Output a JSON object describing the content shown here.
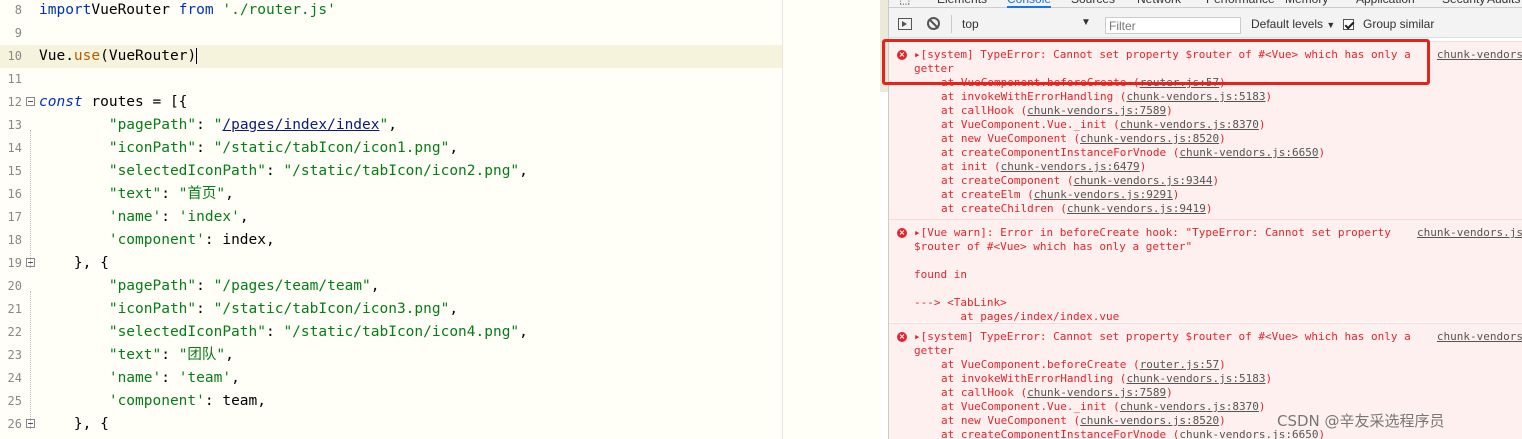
{
  "editor": {
    "lines": [
      {
        "n": "8",
        "indent": 0,
        "parts": [
          [
            "kw",
            "import"
          ],
          [
            "",
            "VueRouter "
          ],
          [
            "kw",
            "from"
          ],
          [
            "",
            " "
          ],
          [
            "str",
            "'./router.js'"
          ]
        ]
      },
      {
        "n": "9",
        "indent": 0,
        "parts": []
      },
      {
        "n": "10",
        "indent": 0,
        "hl": true,
        "parts": [
          [
            "",
            "Vue."
          ],
          [
            "fn",
            "use"
          ],
          [
            "",
            "(VueRouter"
          ],
          [
            "cursor",
            ")"
          ]
        ]
      },
      {
        "n": "11",
        "indent": 0,
        "parts": []
      },
      {
        "n": "12",
        "indent": 0,
        "fold": true,
        "parts": [
          [
            "kwi",
            "const"
          ],
          [
            "",
            " routes = [{"
          ]
        ]
      },
      {
        "n": "13",
        "indent": 0,
        "parts": [
          [
            "",
            "        "
          ],
          [
            "str",
            "\"pagePath\""
          ],
          [
            "",
            ": "
          ],
          [
            "str",
            "\""
          ],
          [
            "strpath",
            "/pages/index/index"
          ],
          [
            "str",
            "\""
          ],
          [
            "",
            ","
          ]
        ]
      },
      {
        "n": "14",
        "indent": 0,
        "parts": [
          [
            "",
            "        "
          ],
          [
            "str",
            "\"iconPath\""
          ],
          [
            "",
            ": "
          ],
          [
            "str",
            "\"/static/tabIcon/icon1.png\""
          ],
          [
            "",
            ","
          ]
        ]
      },
      {
        "n": "15",
        "indent": 0,
        "parts": [
          [
            "",
            "        "
          ],
          [
            "str",
            "\"selectedIconPath\""
          ],
          [
            "",
            ": "
          ],
          [
            "str",
            "\"/static/tabIcon/icon2.png\""
          ],
          [
            "",
            ","
          ]
        ]
      },
      {
        "n": "16",
        "indent": 0,
        "parts": [
          [
            "",
            "        "
          ],
          [
            "str",
            "\"text\""
          ],
          [
            "",
            ": "
          ],
          [
            "str",
            "\"首页\""
          ],
          [
            "",
            ","
          ]
        ]
      },
      {
        "n": "17",
        "indent": 0,
        "parts": [
          [
            "",
            "        "
          ],
          [
            "str",
            "'name'"
          ],
          [
            "",
            ": "
          ],
          [
            "str",
            "'index'"
          ],
          [
            "",
            ","
          ]
        ]
      },
      {
        "n": "18",
        "indent": 0,
        "parts": [
          [
            "",
            "        "
          ],
          [
            "str",
            "'component'"
          ],
          [
            "",
            ": index,"
          ]
        ]
      },
      {
        "n": "19",
        "indent": 0,
        "fold": true,
        "parts": [
          [
            "",
            "    }, {"
          ]
        ]
      },
      {
        "n": "20",
        "indent": 0,
        "parts": [
          [
            "",
            "        "
          ],
          [
            "str",
            "\"pagePath\""
          ],
          [
            "",
            ": "
          ],
          [
            "str",
            "\"/pages/team/team\""
          ],
          [
            "",
            ","
          ]
        ]
      },
      {
        "n": "21",
        "indent": 0,
        "parts": [
          [
            "",
            "        "
          ],
          [
            "str",
            "\"iconPath\""
          ],
          [
            "",
            ": "
          ],
          [
            "str",
            "\"/static/tabIcon/icon3.png\""
          ],
          [
            "",
            ","
          ]
        ]
      },
      {
        "n": "22",
        "indent": 0,
        "parts": [
          [
            "",
            "        "
          ],
          [
            "str",
            "\"selectedIconPath\""
          ],
          [
            "",
            ": "
          ],
          [
            "str",
            "\"/static/tabIcon/icon4.png\""
          ],
          [
            "",
            ","
          ]
        ]
      },
      {
        "n": "23",
        "indent": 0,
        "parts": [
          [
            "",
            "        "
          ],
          [
            "str",
            "\"text\""
          ],
          [
            "",
            ": "
          ],
          [
            "str",
            "\"团队\""
          ],
          [
            "",
            ","
          ]
        ]
      },
      {
        "n": "24",
        "indent": 0,
        "parts": [
          [
            "",
            "        "
          ],
          [
            "str",
            "'name'"
          ],
          [
            "",
            ": "
          ],
          [
            "str",
            "'team'"
          ],
          [
            "",
            ","
          ]
        ]
      },
      {
        "n": "25",
        "indent": 0,
        "parts": [
          [
            "",
            "        "
          ],
          [
            "str",
            "'component'"
          ],
          [
            "",
            ": team,"
          ]
        ]
      },
      {
        "n": "26",
        "indent": 0,
        "fold": true,
        "parts": [
          [
            "",
            "    }, {"
          ]
        ]
      }
    ]
  },
  "devtools": {
    "tabs": [
      "Elements",
      "Console",
      "Sources",
      "Network",
      "Performance",
      "Memory",
      "Application",
      "Security",
      "Audits"
    ],
    "active_tab": "Console",
    "toolbar": {
      "context": "top",
      "filter_placeholder": "Filter",
      "levels": "Default levels",
      "group_similar": "Group similar"
    },
    "messages": [
      {
        "lines": [
          "▸[system] TypeError: Cannot set property $router of #<Vue> which has only a",
          "getter"
        ],
        "source": "chunk-vendors",
        "trace": [
          [
            "at VueComponent.beforeCreate (",
            "router.js:57",
            ")"
          ],
          [
            "at invokeWithErrorHandling (",
            "chunk-vendors.js:5183",
            ")"
          ],
          [
            "at callHook (",
            "chunk-vendors.js:7589",
            ")"
          ],
          [
            "at VueComponent.Vue._init (",
            "chunk-vendors.js:8370",
            ")"
          ],
          [
            "at new VueComponent (",
            "chunk-vendors.js:8520",
            ")"
          ],
          [
            "at createComponentInstanceForVnode (",
            "chunk-vendors.js:6650",
            ")"
          ],
          [
            "at init (",
            "chunk-vendors.js:6479",
            ")"
          ],
          [
            "at createComponent (",
            "chunk-vendors.js:9344",
            ")"
          ],
          [
            "at createElm (",
            "chunk-vendors.js:9291",
            ")"
          ],
          [
            "at createChildren (",
            "chunk-vendors.js:9419",
            ")"
          ]
        ]
      },
      {
        "lines": [
          "▸[Vue warn]: Error in beforeCreate hook: \"TypeError: Cannot set property",
          "$router of #<Vue> which has only a getter\"",
          "",
          "found in",
          "",
          "---> <TabLink>",
          "       at pages/index/index.vue"
        ],
        "source": "chunk-vendors.js",
        "trace": []
      },
      {
        "lines": [
          "▸[system] TypeError: Cannot set property $router of #<Vue> which has only a",
          "getter"
        ],
        "source": "chunk-vendors",
        "trace": [
          [
            "at VueComponent.beforeCreate (",
            "router.js:57",
            ")"
          ],
          [
            "at invokeWithErrorHandling (",
            "chunk-vendors.js:5183",
            ")"
          ],
          [
            "at callHook (",
            "chunk-vendors.js:7589",
            ")"
          ],
          [
            "at VueComponent.Vue._init (",
            "chunk-vendors.js:8370",
            ")"
          ],
          [
            "at new VueComponent (",
            "chunk-vendors.js:8520",
            ")"
          ],
          [
            "at createComponentInstanceForVnode (",
            "chunk-vendors.js:6650",
            ")"
          ]
        ]
      }
    ]
  },
  "watermark": "CSDN @辛友采选程序员",
  "colors": {
    "highlight": "#e8221a",
    "error": "#e0262d"
  }
}
